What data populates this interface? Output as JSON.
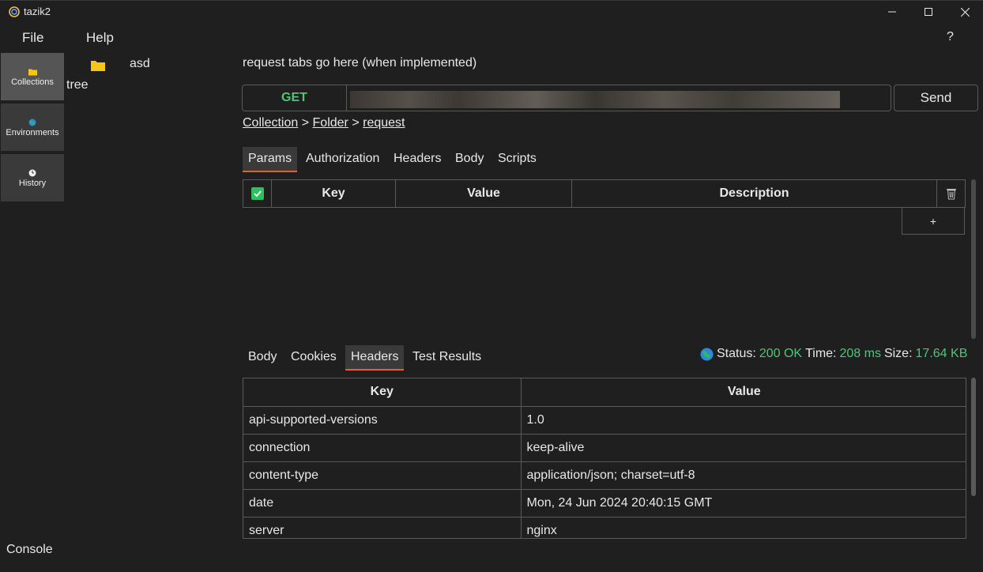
{
  "window": {
    "title": "tazik2"
  },
  "menu": {
    "file": "File",
    "help": "Help",
    "question": "?"
  },
  "sidebar": {
    "items": [
      {
        "label": "Collections",
        "icon": "folder-icon"
      },
      {
        "label": "Environments",
        "icon": "globe-icon"
      },
      {
        "label": "History",
        "icon": "clock-icon"
      }
    ]
  },
  "tree": {
    "label": "tree",
    "items": [
      {
        "label": "asd",
        "icon": "folder-icon"
      }
    ]
  },
  "request": {
    "tabs_placeholder": "request tabs go here (when implemented)",
    "method": "GET",
    "url": "",
    "send_label": "Send",
    "breadcrumb": {
      "collection": "Collection",
      "folder": "Folder",
      "request": "request",
      "separator": ">"
    },
    "tabs": [
      "Params",
      "Authorization",
      "Headers",
      "Body",
      "Scripts"
    ],
    "active_tab": "Params",
    "params_table": {
      "columns": [
        "Key",
        "Value",
        "Description"
      ],
      "add_label": "+"
    }
  },
  "response": {
    "tabs": [
      "Body",
      "Cookies",
      "Headers",
      "Test Results"
    ],
    "active_tab": "Headers",
    "status_label": "Status:",
    "status_value": "200 OK",
    "time_label": "Time:",
    "time_value": "208 ms",
    "size_label": "Size:",
    "size_value": "17.64 KB",
    "headers_table": {
      "columns": [
        "Key",
        "Value"
      ],
      "rows": [
        [
          "api-supported-versions",
          "1.0"
        ],
        [
          "connection",
          "keep-alive"
        ],
        [
          "content-type",
          "application/json; charset=utf-8"
        ],
        [
          "date",
          "Mon, 24 Jun 2024 20:40:15 GMT"
        ],
        [
          "server",
          "nginx"
        ]
      ]
    }
  },
  "console": {
    "label": "Console"
  },
  "colors": {
    "background": "#1f1f1f",
    "accent_tab": "#e2612d",
    "method_get": "#4fc57a",
    "status_ok": "#4fc57a",
    "checkbox": "#2fbf60"
  }
}
